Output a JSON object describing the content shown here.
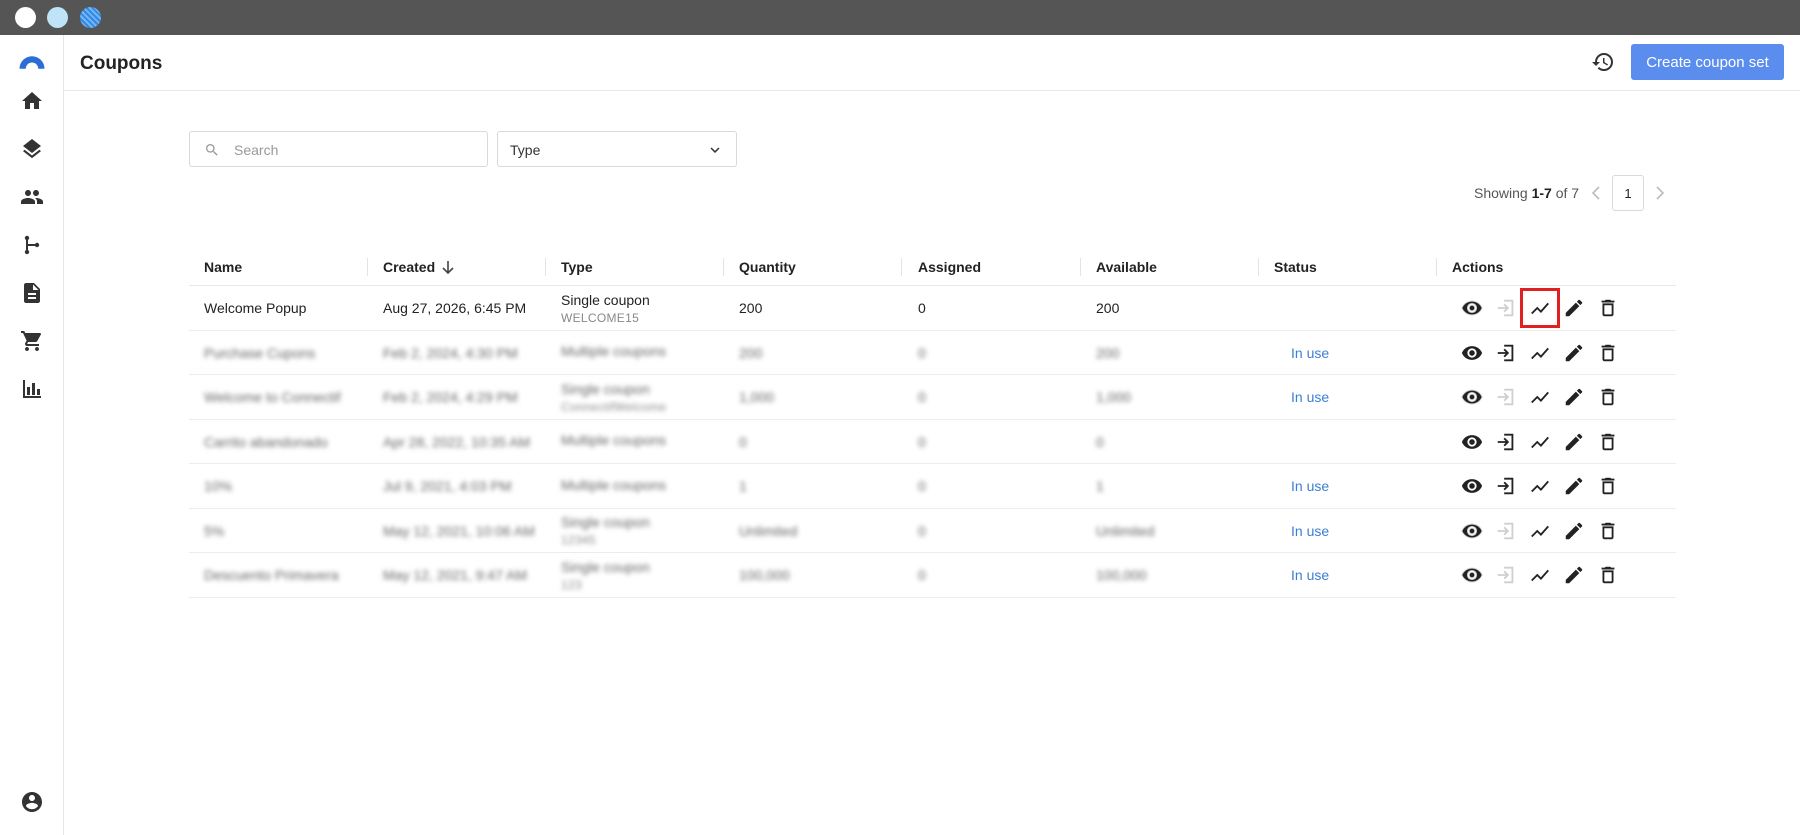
{
  "header": {
    "title": "Coupons",
    "create_label": "Create coupon set"
  },
  "filters": {
    "search_placeholder": "Search",
    "type_label": "Type"
  },
  "pagination": {
    "prefix": "Showing ",
    "range": "1-7",
    "suffix": " of 7",
    "page": "1"
  },
  "table": {
    "columns": [
      "Name",
      "Created",
      "Type",
      "Quantity",
      "Assigned",
      "Available",
      "Status",
      "Actions"
    ],
    "rows": [
      {
        "name": "Welcome Popup",
        "created": "Aug 27, 2026, 6:45 PM",
        "type": "Single coupon",
        "code": "WELCOME15",
        "quantity": "200",
        "assigned": "0",
        "available": "200",
        "status": ""
      },
      {
        "name": "Purchase Cupons",
        "created": "Feb 2, 2024, 4:30 PM",
        "type": "Multiple coupons",
        "code": "",
        "quantity": "200",
        "assigned": "0",
        "available": "200",
        "status": "In use"
      },
      {
        "name": "Welcome to Connectif",
        "created": "Feb 2, 2024, 4:29 PM",
        "type": "Single coupon",
        "code": "ConnectifWelcome",
        "quantity": "1,000",
        "assigned": "0",
        "available": "1,000",
        "status": "In use"
      },
      {
        "name": "Carrito abandonado",
        "created": "Apr 28, 2022, 10:35 AM",
        "type": "Multiple coupons",
        "code": "",
        "quantity": "0",
        "assigned": "0",
        "available": "0",
        "status": ""
      },
      {
        "name": "10%",
        "created": "Jul 9, 2021, 4:03 PM",
        "type": "Multiple coupons",
        "code": "",
        "quantity": "1",
        "assigned": "0",
        "available": "1",
        "status": "In use"
      },
      {
        "name": "5%",
        "created": "May 12, 2021, 10:06 AM",
        "type": "Single coupon",
        "code": "12345",
        "quantity": "Unlimited",
        "assigned": "0",
        "available": "Unlimited",
        "status": "In use"
      },
      {
        "name": "Descuento Primavera",
        "created": "May 12, 2021, 9:47 AM",
        "type": "Single coupon",
        "code": "123",
        "quantity": "100,000",
        "assigned": "0",
        "available": "100,000",
        "status": "In use"
      }
    ]
  },
  "colors": {
    "accent": "#5b8def",
    "status": "#3b7fd4",
    "highlight": "#e02020"
  },
  "icons": [
    "logo-icon",
    "home-icon",
    "layers-icon",
    "people-icon",
    "flow-icon",
    "document-icon",
    "cart-icon",
    "bar-chart-icon",
    "account-icon",
    "history-icon",
    "search-icon",
    "chevron-down-icon",
    "eye-icon",
    "assign-icon",
    "trend-icon",
    "edit-icon",
    "delete-icon"
  ]
}
